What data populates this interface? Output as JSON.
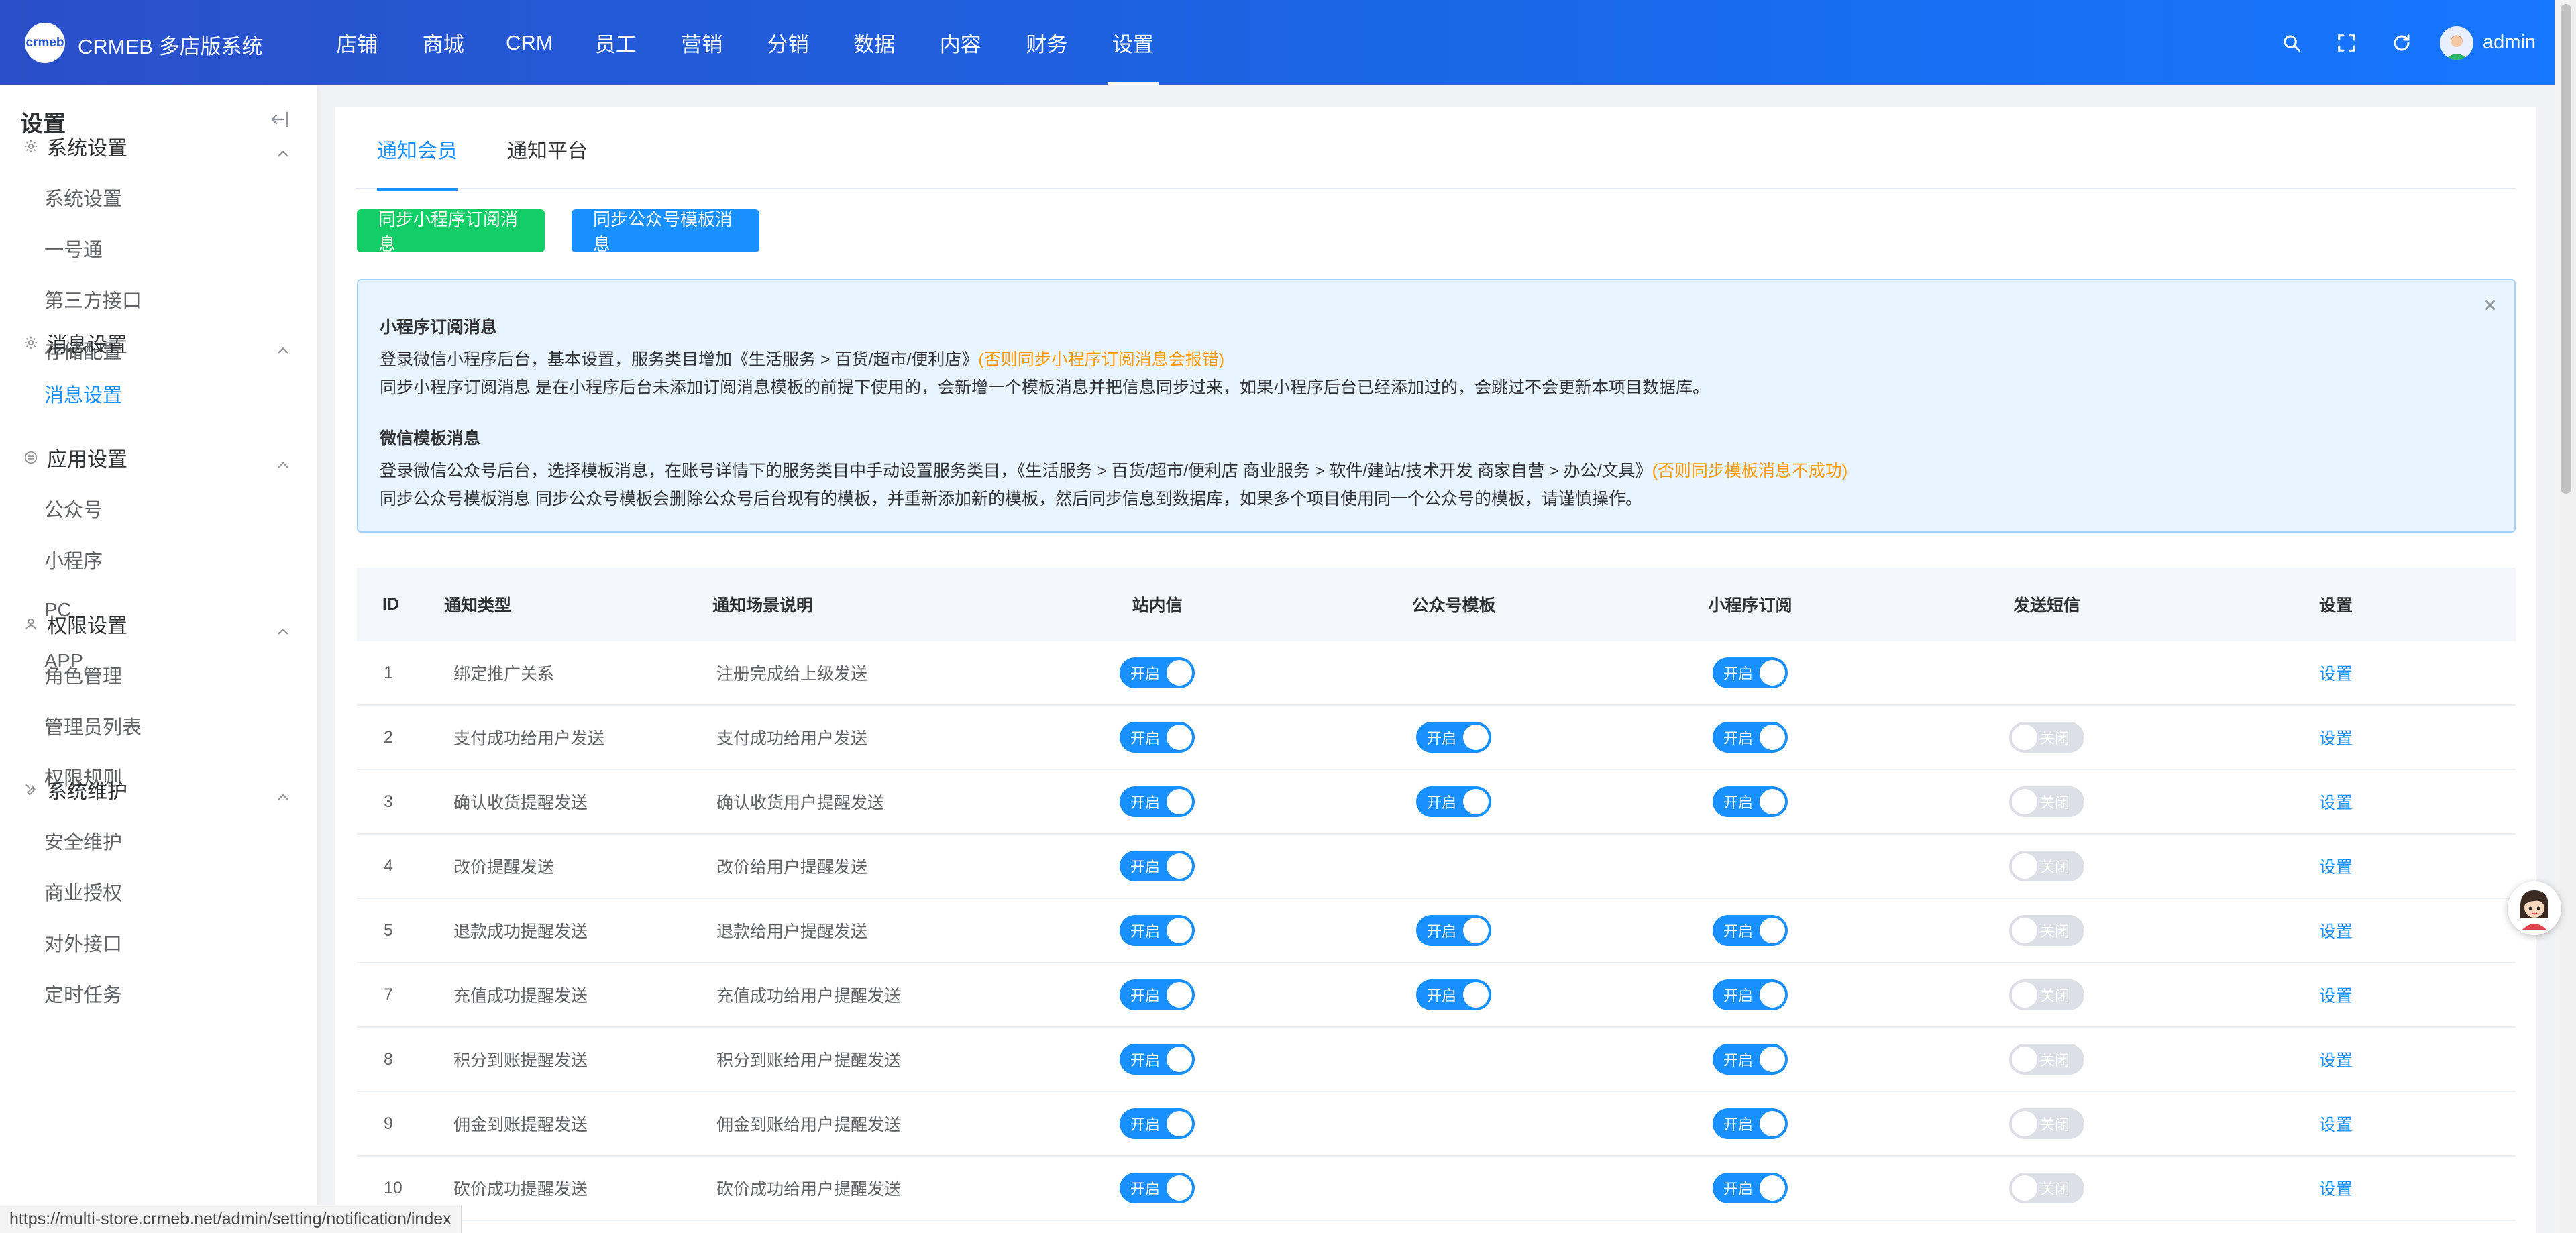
{
  "header": {
    "brand": "CRMEB 多店版系统",
    "logo_text": "crmeb",
    "nav": [
      {
        "label": "店铺",
        "active": false
      },
      {
        "label": "商城",
        "active": false
      },
      {
        "label": "CRM",
        "active": false
      },
      {
        "label": "员工",
        "active": false
      },
      {
        "label": "营销",
        "active": false
      },
      {
        "label": "分销",
        "active": false
      },
      {
        "label": "数据",
        "active": false
      },
      {
        "label": "内容",
        "active": false
      },
      {
        "label": "财务",
        "active": false
      },
      {
        "label": "设置",
        "active": true
      }
    ],
    "icons": [
      "search-icon",
      "fullscreen-icon",
      "refresh-icon"
    ],
    "username": "admin"
  },
  "sidebar": {
    "title": "设置",
    "groups": [
      {
        "title": "系统设置",
        "icon": "gear-icon",
        "items": [
          {
            "label": "系统设置"
          },
          {
            "label": "一号通"
          },
          {
            "label": "第三方接口"
          },
          {
            "label": "存储配置"
          }
        ]
      },
      {
        "title": "消息设置",
        "icon": "gear-icon",
        "items": [
          {
            "label": "消息设置",
            "active": true
          }
        ]
      },
      {
        "title": "应用设置",
        "icon": "app-icon",
        "items": [
          {
            "label": "公众号"
          },
          {
            "label": "小程序"
          },
          {
            "label": "PC"
          },
          {
            "label": "APP"
          }
        ]
      },
      {
        "title": "权限设置",
        "icon": "user-icon",
        "items": [
          {
            "label": "角色管理"
          },
          {
            "label": "管理员列表"
          },
          {
            "label": "权限规则"
          }
        ]
      },
      {
        "title": "系统维护",
        "icon": "tools-icon",
        "items": [
          {
            "label": "安全维护"
          },
          {
            "label": "商业授权"
          },
          {
            "label": "对外接口"
          },
          {
            "label": "定时任务"
          }
        ]
      }
    ]
  },
  "tabs": [
    {
      "label": "通知会员",
      "active": true
    },
    {
      "label": "通知平台",
      "active": false
    }
  ],
  "buttons": {
    "sync_mini": "同步小程序订阅消息",
    "sync_wechat": "同步公众号模板消息"
  },
  "alert": {
    "close": "×",
    "mini_title": "小程序订阅消息",
    "mini_line1": "登录微信小程序后台，基本设置，服务类目增加《生活服务 > 百货/超市/便利店》",
    "mini_line1_warn": "(否则同步小程序订阅消息会报错)",
    "mini_line2": "同步小程序订阅消息 是在小程序后台未添加订阅消息模板的前提下使用的，会新增一个模板消息并把信息同步过来，如果小程序后台已经添加过的，会跳过不会更新本项目数据库。",
    "wx_title": "微信模板消息",
    "wx_line1": "登录微信公众号后台，选择模板消息，在账号详情下的服务类目中手动设置服务类目，《生活服务 > 百货/超市/便利店 商业服务 > 软件/建站/技术开发 商家自营 > 办公/文具》",
    "wx_line1_warn": "(否则同步模板消息不成功)",
    "wx_line2": "同步公众号模板消息 同步公众号模板会删除公众号后台现有的模板，并重新添加新的模板，然后同步信息到数据库，如果多个项目使用同一个公众号的模板，请谨慎操作。"
  },
  "table": {
    "headers": {
      "id": "ID",
      "type": "通知类型",
      "desc": "通知场景说明",
      "site": "站内信",
      "wechat": "公众号模板",
      "mini": "小程序订阅",
      "sms": "发送短信",
      "setting": "设置"
    },
    "switch_on": "开启",
    "switch_off": "关闭",
    "setting_link": "设置",
    "rows": [
      {
        "id": "1",
        "type": "绑定推广关系",
        "desc": "注册完成给上级发送",
        "site": "on",
        "wechat": null,
        "mini": "on",
        "sms": null
      },
      {
        "id": "2",
        "type": "支付成功给用户发送",
        "desc": "支付成功给用户发送",
        "site": "on",
        "wechat": "on",
        "mini": "on",
        "sms": "off"
      },
      {
        "id": "3",
        "type": "确认收货提醒发送",
        "desc": "确认收货用户提醒发送",
        "site": "on",
        "wechat": "on",
        "mini": "on",
        "sms": "off"
      },
      {
        "id": "4",
        "type": "改价提醒发送",
        "desc": "改价给用户提醒发送",
        "site": "on",
        "wechat": null,
        "mini": null,
        "sms": "off"
      },
      {
        "id": "5",
        "type": "退款成功提醒发送",
        "desc": "退款给用户提醒发送",
        "site": "on",
        "wechat": "on",
        "mini": "on",
        "sms": "off"
      },
      {
        "id": "7",
        "type": "充值成功提醒发送",
        "desc": "充值成功给用户提醒发送",
        "site": "on",
        "wechat": "on",
        "mini": "on",
        "sms": "off"
      },
      {
        "id": "8",
        "type": "积分到账提醒发送",
        "desc": "积分到账给用户提醒发送",
        "site": "on",
        "wechat": null,
        "mini": "on",
        "sms": "off"
      },
      {
        "id": "9",
        "type": "佣金到账提醒发送",
        "desc": "佣金到账给用户提醒发送",
        "site": "on",
        "wechat": null,
        "mini": "on",
        "sms": "off"
      },
      {
        "id": "10",
        "type": "砍价成功提醒发送",
        "desc": "砍价成功给用户提醒发送",
        "site": "on",
        "wechat": null,
        "mini": "on",
        "sms": "off"
      }
    ]
  },
  "statusbar": "https://multi-store.crmeb.net/admin/setting/notification/index",
  "colors": {
    "primary": "#1890ff",
    "success": "#13ce66",
    "warning": "#ff9900",
    "header_gradient_start": "#2b4fc8",
    "header_gradient_end": "#1677ff"
  }
}
